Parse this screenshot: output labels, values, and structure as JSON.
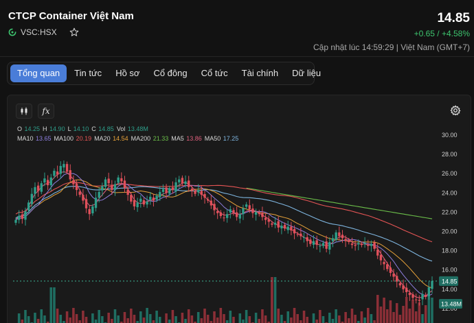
{
  "header": {
    "company_name": "CTCP Container Việt Nam",
    "ticker": "VSC:HSX",
    "price": "14.85",
    "change": "+0.65 / +4.58%",
    "updated": "Cập nhật lúc 14:59:29 | Việt Nam (GMT+7)",
    "icons": {
      "ticker": "exchange-logo-icon",
      "watch": "star-icon"
    }
  },
  "tabs": [
    {
      "label": "Tổng quan",
      "active": true
    },
    {
      "label": "Tin tức",
      "active": false
    },
    {
      "label": "Hồ sơ",
      "active": false
    },
    {
      "label": "Cổ đông",
      "active": false
    },
    {
      "label": "Cổ tức",
      "active": false
    },
    {
      "label": "Tài chính",
      "active": false
    },
    {
      "label": "Dữ liệu",
      "active": false
    }
  ],
  "toolbar": {
    "icons": [
      "candlestick-icon",
      "function-icon",
      "gear-icon"
    ],
    "indicator_label": "fx"
  },
  "legend": {
    "ohlc": [
      {
        "k": "O",
        "v": "14.25"
      },
      {
        "k": "H",
        "v": "14.90"
      },
      {
        "k": "L",
        "v": "14.10"
      },
      {
        "k": "C",
        "v": "14.85"
      },
      {
        "k": "Vol",
        "v": "13.48M"
      }
    ],
    "ma": [
      {
        "k": "MA10",
        "v": "13.65",
        "color": "#8f7fe0"
      },
      {
        "k": "MA100",
        "v": "20.19",
        "color": "#e65555"
      },
      {
        "k": "MA20",
        "v": "14.54",
        "color": "#e8a33a"
      },
      {
        "k": "MA200",
        "v": "21.33",
        "color": "#6cc04a"
      },
      {
        "k": "MA5",
        "v": "13.86",
        "color": "#e0607e"
      },
      {
        "k": "MA50",
        "v": "17.25",
        "color": "#7fb6e0"
      }
    ]
  },
  "colors": {
    "up": "#2e9e8a",
    "down": "#e0505a",
    "accent": "#4a7dd8",
    "positive": "#3dc46e"
  },
  "chart_data": {
    "type": "candlestick",
    "y_ticks": [
      "30.00",
      "28.00",
      "26.00",
      "24.00",
      "22.00",
      "20.00",
      "18.00",
      "16.00",
      "14.00",
      "12.00"
    ],
    "ylim": [
      11,
      30
    ],
    "last_price_label": "14.85",
    "last_volume_label": "13.48M",
    "close": [
      21.2,
      21.6,
      21.3,
      22.1,
      23.0,
      23.9,
      24.6,
      24.2,
      25.0,
      25.5,
      24.8,
      25.6,
      26.3,
      25.9,
      26.8,
      27.0,
      26.2,
      25.4,
      24.9,
      24.3,
      23.8,
      23.2,
      22.4,
      21.8,
      22.6,
      23.5,
      24.1,
      24.7,
      25.4,
      25.0,
      24.3,
      24.9,
      25.6,
      25.2,
      24.5,
      23.8,
      23.1,
      22.6,
      23.0,
      23.4,
      22.8,
      23.1,
      23.6,
      23.2,
      23.7,
      24.1,
      24.4,
      24.0,
      24.5,
      24.3,
      25.1,
      25.4,
      25.0,
      25.2,
      24.6,
      24.2,
      23.9,
      24.3,
      23.8,
      23.5,
      23.2,
      22.7,
      22.2,
      21.9,
      21.6,
      21.4,
      21.8,
      22.3,
      21.9,
      21.5,
      21.8,
      22.4,
      22.8,
      22.3,
      21.9,
      22.0,
      21.8,
      21.5,
      21.2,
      21.0,
      20.7,
      20.9,
      20.4,
      20.6,
      20.3,
      20.5,
      20.1,
      19.8,
      19.7,
      19.5,
      19.4,
      19.0,
      18.7,
      19.0,
      18.6,
      18.5,
      18.8,
      18.2,
      18.9,
      19.3,
      19.9,
      19.5,
      19.3,
      19.0,
      18.9,
      18.6,
      18.5,
      18.8,
      18.6,
      18.8,
      18.5,
      18.7,
      18.2,
      17.5,
      17.0,
      16.6,
      16.1,
      15.7,
      15.3,
      14.8,
      14.4,
      14.0,
      13.7,
      13.4,
      13.1,
      12.9,
      12.8,
      13.5,
      13.2,
      14.2,
      14.85
    ],
    "ma_series": {
      "MA5": [
        21.3,
        21.5,
        21.6,
        22.0,
        22.6,
        23.3,
        23.9,
        24.2,
        24.6,
        24.9,
        25.0,
        25.2,
        25.6,
        25.9,
        26.1,
        26.2,
        26.1,
        25.8,
        25.4,
        24.9,
        24.3,
        23.7,
        23.1,
        22.7,
        22.7,
        22.9,
        23.4,
        23.8,
        24.2,
        24.6,
        24.7,
        24.8,
        25.0,
        25.0,
        24.9,
        24.4,
        23.9,
        23.3,
        23.0,
        22.9,
        23.0,
        23.1,
        23.2,
        23.3,
        23.5,
        23.7,
        23.9,
        24.0,
        24.2,
        24.4,
        24.6,
        24.8,
        25.0,
        25.1,
        24.9,
        24.6,
        24.3,
        24.1,
        23.9,
        23.6,
        23.3,
        23.0,
        22.6,
        22.2,
        21.9,
        21.7,
        21.7,
        21.8,
        21.9,
        21.8,
        21.8,
        21.9,
        22.1,
        22.2,
        22.2,
        22.1,
        21.9,
        21.7,
        21.5,
        21.3,
        21.0,
        20.8,
        20.6,
        20.5,
        20.4,
        20.3,
        20.2,
        20.0,
        19.8,
        19.6,
        19.4,
        19.2,
        19.0,
        18.8,
        18.7,
        18.6,
        18.6,
        18.5,
        18.6,
        18.9,
        19.2,
        19.4,
        19.5,
        19.4,
        19.2,
        18.9,
        18.7,
        18.7,
        18.7,
        18.7,
        18.6,
        18.6,
        18.5,
        18.2,
        17.7,
        17.2,
        16.7,
        16.2,
        15.7,
        15.2,
        14.8,
        14.4,
        14.0,
        13.7,
        13.4,
        13.2,
        13.1,
        13.2,
        13.3,
        13.6,
        13.86
      ]
    }
  }
}
